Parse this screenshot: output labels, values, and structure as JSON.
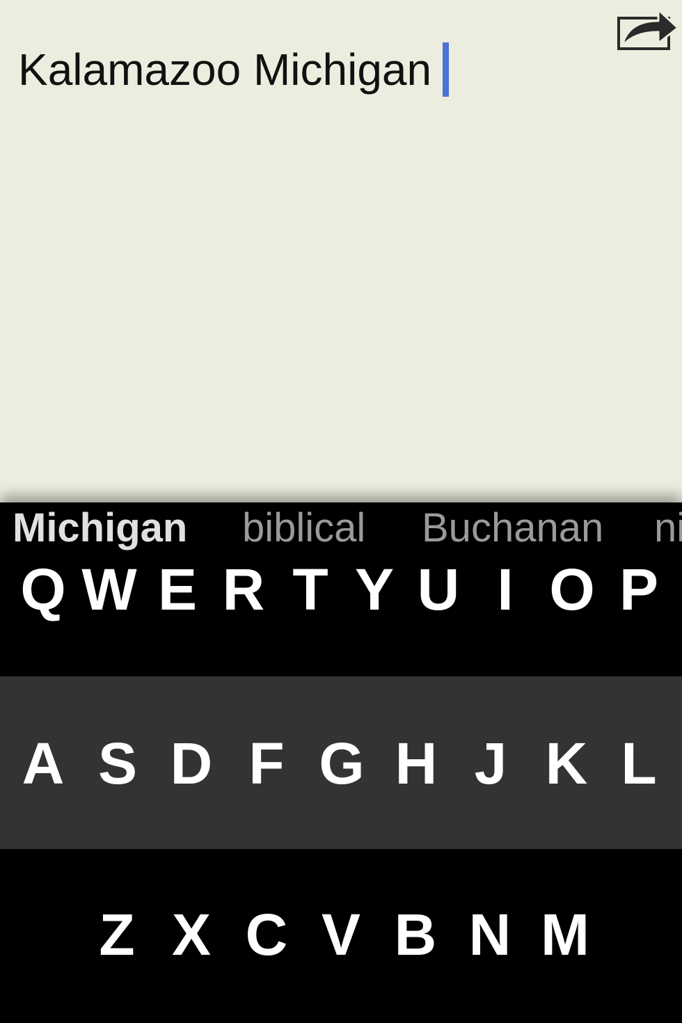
{
  "editor": {
    "text": "Kalamazoo Michigan",
    "share_icon": "share-arrow-icon"
  },
  "suggestions": [
    {
      "label": "Michigan",
      "primary": true
    },
    {
      "label": "biblical",
      "primary": false
    },
    {
      "label": "Buchanan",
      "primary": false
    },
    {
      "label": "ni",
      "primary": false
    }
  ],
  "keyboard": {
    "rows": [
      [
        "Q",
        "W",
        "E",
        "R",
        "T",
        "Y",
        "U",
        "I",
        "O",
        "P"
      ],
      [
        "A",
        "S",
        "D",
        "F",
        "G",
        "H",
        "J",
        "K",
        "L"
      ],
      [
        "Z",
        "X",
        "C",
        "V",
        "B",
        "N",
        "M"
      ]
    ]
  },
  "colors": {
    "background": "#ededdf",
    "cursor": "#4a72d8",
    "keyboard": "#000000",
    "middle_row": "#333333",
    "key_text": "#ffffff",
    "suggestion_primary": "#e0e0e0",
    "suggestion_secondary": "#9a9a9a"
  }
}
